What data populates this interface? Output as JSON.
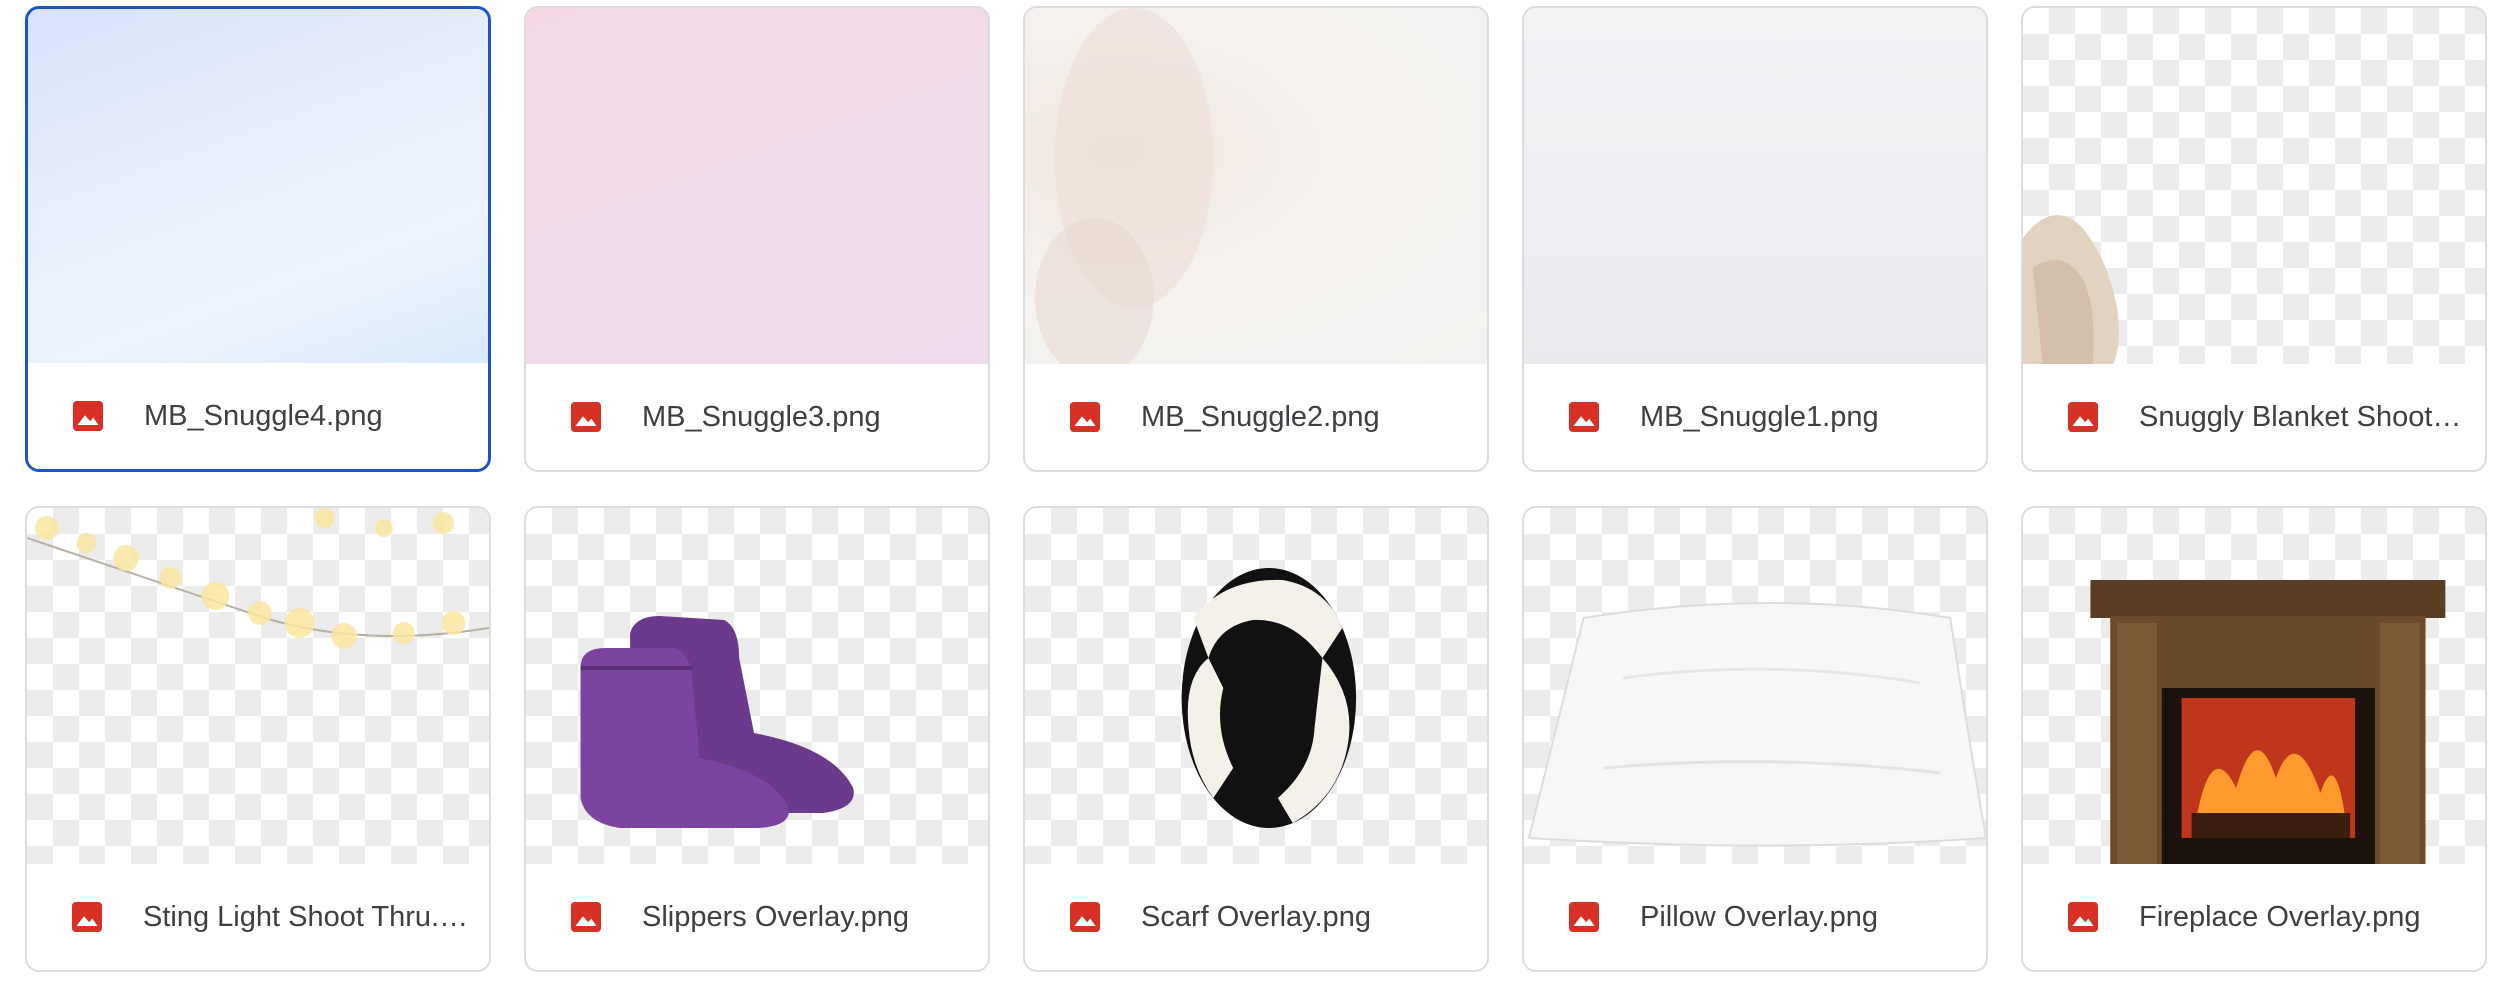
{
  "files": [
    {
      "name": "MB_Snuggle4.png",
      "selected": true,
      "icon": "image-file-icon"
    },
    {
      "name": "MB_Snuggle3.png",
      "icon": "image-file-icon"
    },
    {
      "name": "MB_Snuggle2.png",
      "icon": "image-file-icon"
    },
    {
      "name": "MB_Snuggle1.png",
      "icon": "image-file-icon"
    },
    {
      "name": "Snuggly Blanket Shoot…",
      "icon": "image-file-icon"
    },
    {
      "name": "Sting Light Shoot Thru.…",
      "icon": "image-file-icon"
    },
    {
      "name": "Slippers Overlay.png",
      "icon": "image-file-icon"
    },
    {
      "name": "Scarf Overlay.png",
      "icon": "image-file-icon"
    },
    {
      "name": "Pillow Overlay.png",
      "icon": "image-file-icon"
    },
    {
      "name": "Fireplace Overlay.png",
      "icon": "image-file-icon"
    }
  ],
  "colors": {
    "selected_border": "#1a56c4",
    "card_border": "#dadce0",
    "file_icon": "#d93025",
    "text": "#3c4043"
  }
}
